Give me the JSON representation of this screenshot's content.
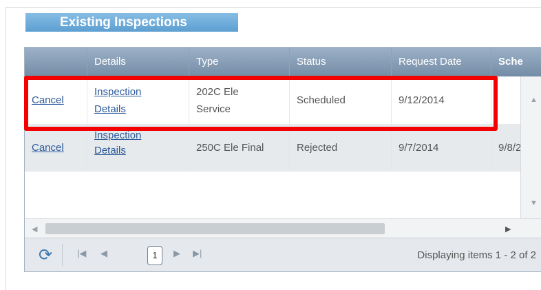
{
  "section_title": "Existing Inspections",
  "grid": {
    "columns": [
      "",
      "Details",
      "Type",
      "Status",
      "Request Date",
      "Sche"
    ],
    "rows": [
      {
        "action": "Cancel",
        "details_line1": "Inspection",
        "details_line2": "Details",
        "type_line1": "202C Ele",
        "type_line2": "Service",
        "status": "Scheduled",
        "request_date": "9/12/2014",
        "scheduled": ""
      },
      {
        "action": "Cancel",
        "details_line1": "Inspection",
        "details_line2": "Details",
        "type": "250C Ele Final",
        "status": "Rejected",
        "request_date": "9/7/2014",
        "scheduled": "9/8/2"
      }
    ]
  },
  "pager": {
    "current_page": "1",
    "info": "Displaying items 1 - 2 of 2"
  },
  "icons": {
    "refresh": "refresh-icon",
    "first": "first-page-icon",
    "prev": "prev-page-icon",
    "next": "next-page-icon",
    "last": "last-page-icon"
  },
  "colors": {
    "header_bar": "#5d9fd2",
    "grid_header": "#748ca6",
    "alt_row": "#e6eaed",
    "link": "#2c5a9a",
    "highlight": "#f30000"
  }
}
